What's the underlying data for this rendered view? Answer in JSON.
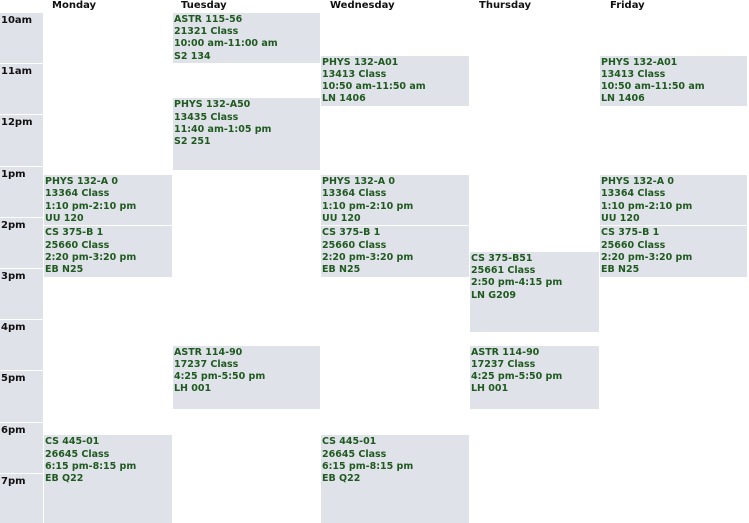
{
  "days": [
    "Monday",
    "Tuesday",
    "Wednesday",
    "Thursday",
    "Friday"
  ],
  "times": [
    "10am",
    "11am",
    "12pm",
    "1pm",
    "2pm",
    "3pm",
    "4pm",
    "5pm",
    "6pm",
    "7pm"
  ],
  "events": [
    {
      "day": 1,
      "course": "ASTR 115-56",
      "class_no": "21321 Class",
      "time": "10:00 am-11:00 am",
      "room": "S2 134",
      "start": 10.0,
      "end": 11.0
    },
    {
      "day": 2,
      "course": "PHYS 132-A01",
      "class_no": "13413 Class",
      "time": "10:50 am-11:50 am",
      "room": "LN 1406",
      "start": 10.833,
      "end": 11.833
    },
    {
      "day": 4,
      "course": "PHYS 132-A01",
      "class_no": "13413 Class",
      "time": "10:50 am-11:50 am",
      "room": "LN 1406",
      "start": 10.833,
      "end": 11.833
    },
    {
      "day": 1,
      "course": "PHYS 132-A50",
      "class_no": "13435 Class",
      "time": "11:40 am-1:05 pm",
      "room": "S2 251",
      "start": 11.667,
      "end": 13.083
    },
    {
      "day": 0,
      "course": "PHYS 132-A 0",
      "class_no": "13364 Class",
      "time": "1:10 pm-2:10 pm",
      "room": "UU 120",
      "start": 13.167,
      "end": 14.167
    },
    {
      "day": 2,
      "course": "PHYS 132-A 0",
      "class_no": "13364 Class",
      "time": "1:10 pm-2:10 pm",
      "room": "UU 120",
      "start": 13.167,
      "end": 14.167
    },
    {
      "day": 4,
      "course": "PHYS 132-A 0",
      "class_no": "13364 Class",
      "time": "1:10 pm-2:10 pm",
      "room": "UU 120",
      "start": 13.167,
      "end": 14.167
    },
    {
      "day": 0,
      "course": "CS 375-B 1",
      "class_no": "25660 Class",
      "time": "2:20 pm-3:20 pm",
      "room": "EB N25",
      "start": 14.167,
      "end": 15.167
    },
    {
      "day": 2,
      "course": "CS 375-B 1",
      "class_no": "25660 Class",
      "time": "2:20 pm-3:20 pm",
      "room": "EB N25",
      "start": 14.167,
      "end": 15.167
    },
    {
      "day": 4,
      "course": "CS 375-B 1",
      "class_no": "25660 Class",
      "time": "2:20 pm-3:20 pm",
      "room": "EB N25",
      "start": 14.167,
      "end": 15.167
    },
    {
      "day": 3,
      "course": "CS 375-B51",
      "class_no": "25661 Class",
      "time": "2:50 pm-4:15 pm",
      "room": "LN G209",
      "start": 14.667,
      "end": 16.25
    },
    {
      "day": 1,
      "course": "ASTR 114-90",
      "class_no": "17237 Class",
      "time": "4:25 pm-5:50 pm",
      "room": "LH 001",
      "start": 16.5,
      "end": 17.75
    },
    {
      "day": 3,
      "course": "ASTR 114-90",
      "class_no": "17237 Class",
      "time": "4:25 pm-5:50 pm",
      "room": "LH 001",
      "start": 16.5,
      "end": 17.75
    },
    {
      "day": 0,
      "course": "CS 445-01",
      "class_no": "26645 Class",
      "time": "6:15 pm-8:15 pm",
      "room": "EB Q22",
      "start": 18.25,
      "end": 20.0
    },
    {
      "day": 2,
      "course": "CS 445-01",
      "class_no": "26645 Class",
      "time": "6:15 pm-8:15 pm",
      "room": "EB Q22",
      "start": 18.25,
      "end": 20.0
    }
  ]
}
